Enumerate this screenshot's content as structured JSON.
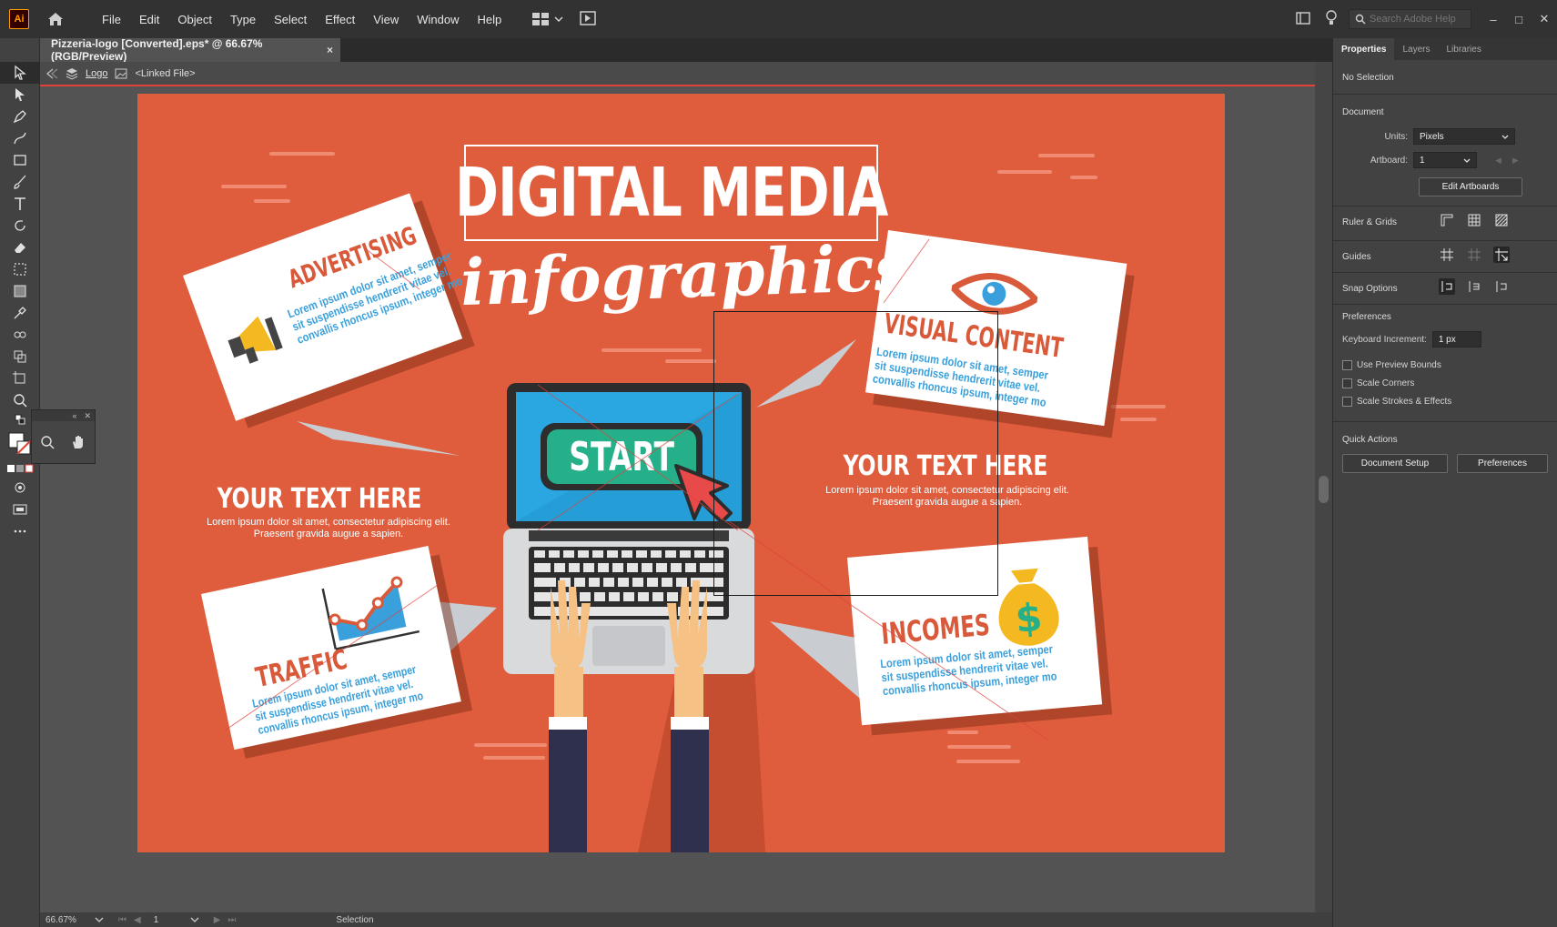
{
  "app": {
    "logo": "Ai",
    "menu": [
      "File",
      "Edit",
      "Object",
      "Type",
      "Select",
      "Effect",
      "View",
      "Window",
      "Help"
    ],
    "search_placeholder": "Search Adobe Help"
  },
  "document": {
    "tab_title": "Pizzeria-logo [Converted].eps* @ 66.67% (RGB/Preview)",
    "tab_close": "×",
    "breadcrumb": {
      "layer": "Logo",
      "item": "<Linked File>"
    }
  },
  "artwork": {
    "title": "DIGITAL MEDIA",
    "subtitle": "infographics",
    "start_button": "START",
    "cards": {
      "advertising": {
        "title": "ADVERTISING",
        "lines": [
          "Lorem ipsum dolor sit amet, semper",
          "sit suspendisse hendrerit vitae vel.",
          "convallis rhoncus ipsum, integer mo"
        ]
      },
      "visual": {
        "title": "VISUAL CONTENT",
        "lines": [
          "Lorem ipsum dolor sit amet, semper",
          "sit suspendisse hendrerit vitae vel.",
          "convallis rhoncus ipsum, integer mo"
        ]
      },
      "traffic": {
        "title": "TRAFFIC",
        "lines": [
          "Lorem ipsum dolor sit amet, semper",
          "sit suspendisse hendrerit vitae vel.",
          "convallis rhoncus ipsum, integer mo"
        ]
      },
      "incomes": {
        "title": "INCOMES",
        "lines": [
          "Lorem ipsum dolor sit amet, semper",
          "sit suspendisse hendrerit vitae vel.",
          "convallis rhoncus ipsum, integer mo"
        ]
      }
    },
    "blocks": {
      "left": {
        "heading": "YOUR TEXT HERE",
        "text": "Lorem ipsum dolor sit amet, consectetur adipiscing elit. Praesent gravida augue a sapien."
      },
      "right": {
        "heading": "YOUR TEXT HERE",
        "text": "Lorem ipsum dolor sit amet, consectetur adipiscing elit. Praesent gravida augue a sapien."
      }
    },
    "dollar_sign": "$"
  },
  "status": {
    "zoom": "66.67%",
    "artboard_num": "1",
    "mode": "Selection"
  },
  "panel": {
    "tabs": [
      "Properties",
      "Layers",
      "Libraries"
    ],
    "active_tab": "Properties",
    "selection": "No Selection",
    "document_title": "Document",
    "units_label": "Units:",
    "units_value": "Pixels",
    "artboard_label": "Artboard:",
    "artboard_value": "1",
    "edit_artboards": "Edit Artboards",
    "ruler_grids": "Ruler & Grids",
    "guides": "Guides",
    "snap_options": "Snap Options",
    "preferences_title": "Preferences",
    "keyboard_increment_label": "Keyboard Increment:",
    "keyboard_increment_value": "1 px",
    "checkboxes": [
      "Use Preview Bounds",
      "Scale Corners",
      "Scale Strokes & Effects"
    ],
    "quick_actions": "Quick Actions",
    "document_setup": "Document Setup",
    "preferences_button": "Preferences"
  },
  "colors": {
    "artboard": "#df5d3c",
    "accent_blue": "#3aa0dc",
    "start_green": "#25b08a",
    "title_red": "#d95a3a"
  }
}
